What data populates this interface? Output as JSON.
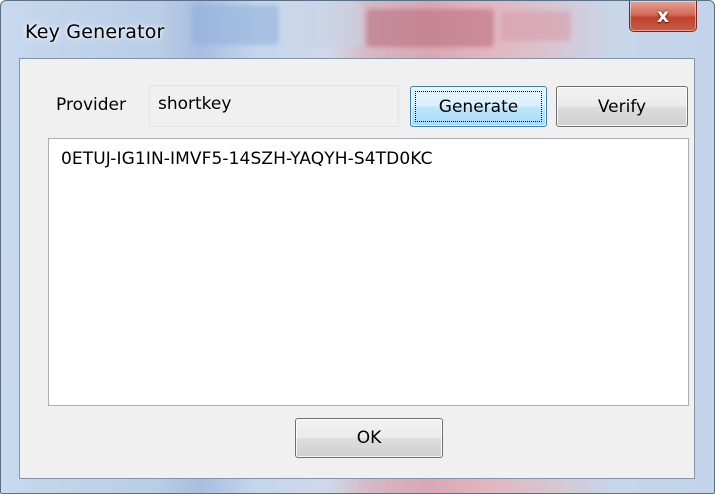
{
  "window": {
    "title": "Key Generator",
    "close_symbol": "x"
  },
  "provider": {
    "label": "Provider",
    "value": "shortkey"
  },
  "buttons": {
    "generate": "Generate",
    "verify": "Verify",
    "ok": "OK"
  },
  "output": {
    "key": "0ETUJ-IG1IN-IMVF5-14SZH-YAQYH-S4TD0KC"
  },
  "colors": {
    "close_button": "#c8432e",
    "focused_button_border": "#3c7fb1",
    "client_background": "#f0f0f0"
  },
  "icons": {
    "close": "close-icon"
  }
}
